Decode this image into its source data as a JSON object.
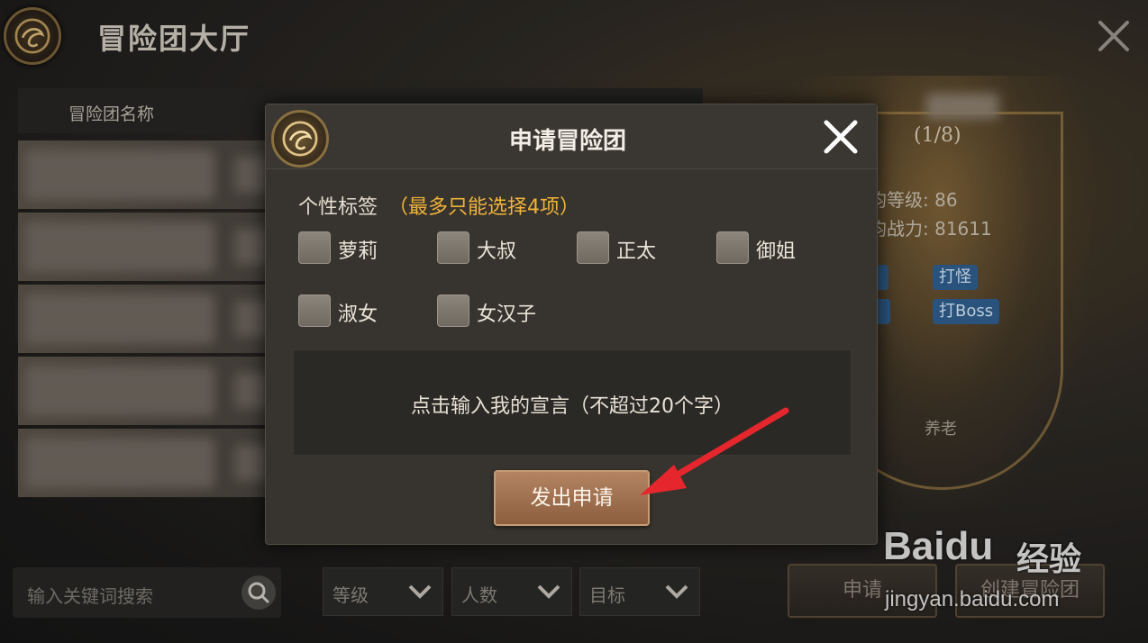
{
  "hall": {
    "title": "冒险团大厅",
    "columns": {
      "name": "冒险团名称"
    },
    "detail": {
      "member_count": "(1/8)",
      "avg_level": "平均等级: 86",
      "avg_power": "平均战力: 81611",
      "tags": [
        "打怪",
        "打Boss"
      ],
      "goal": "养老"
    },
    "search": {
      "placeholder": "输入关键词搜索",
      "icon": "search-icon"
    },
    "filters": [
      {
        "label": "等级"
      },
      {
        "label": "人数"
      },
      {
        "label": "目标"
      }
    ],
    "buttons": {
      "apply": "申请",
      "create": "创建冒险团"
    }
  },
  "modal": {
    "title": "申请冒险团",
    "tags_label": "个性标签",
    "tags_hint": "（最多只能选择4项）",
    "tags": [
      "萝莉",
      "大叔",
      "正太",
      "御姐",
      "淑女",
      "女汉子"
    ],
    "declaration_placeholder": "点击输入我的宣言（不超过20个字）",
    "submit": "发出申请"
  },
  "watermark": {
    "brand": "Baidu",
    "product": "经验",
    "url": "jingyan.baidu.com"
  },
  "colors": {
    "accent_orange": "#f0b23a",
    "submit_brown": "#a07050",
    "annotation_red": "#e6262d",
    "tag_blue": "#2f5f8e"
  }
}
